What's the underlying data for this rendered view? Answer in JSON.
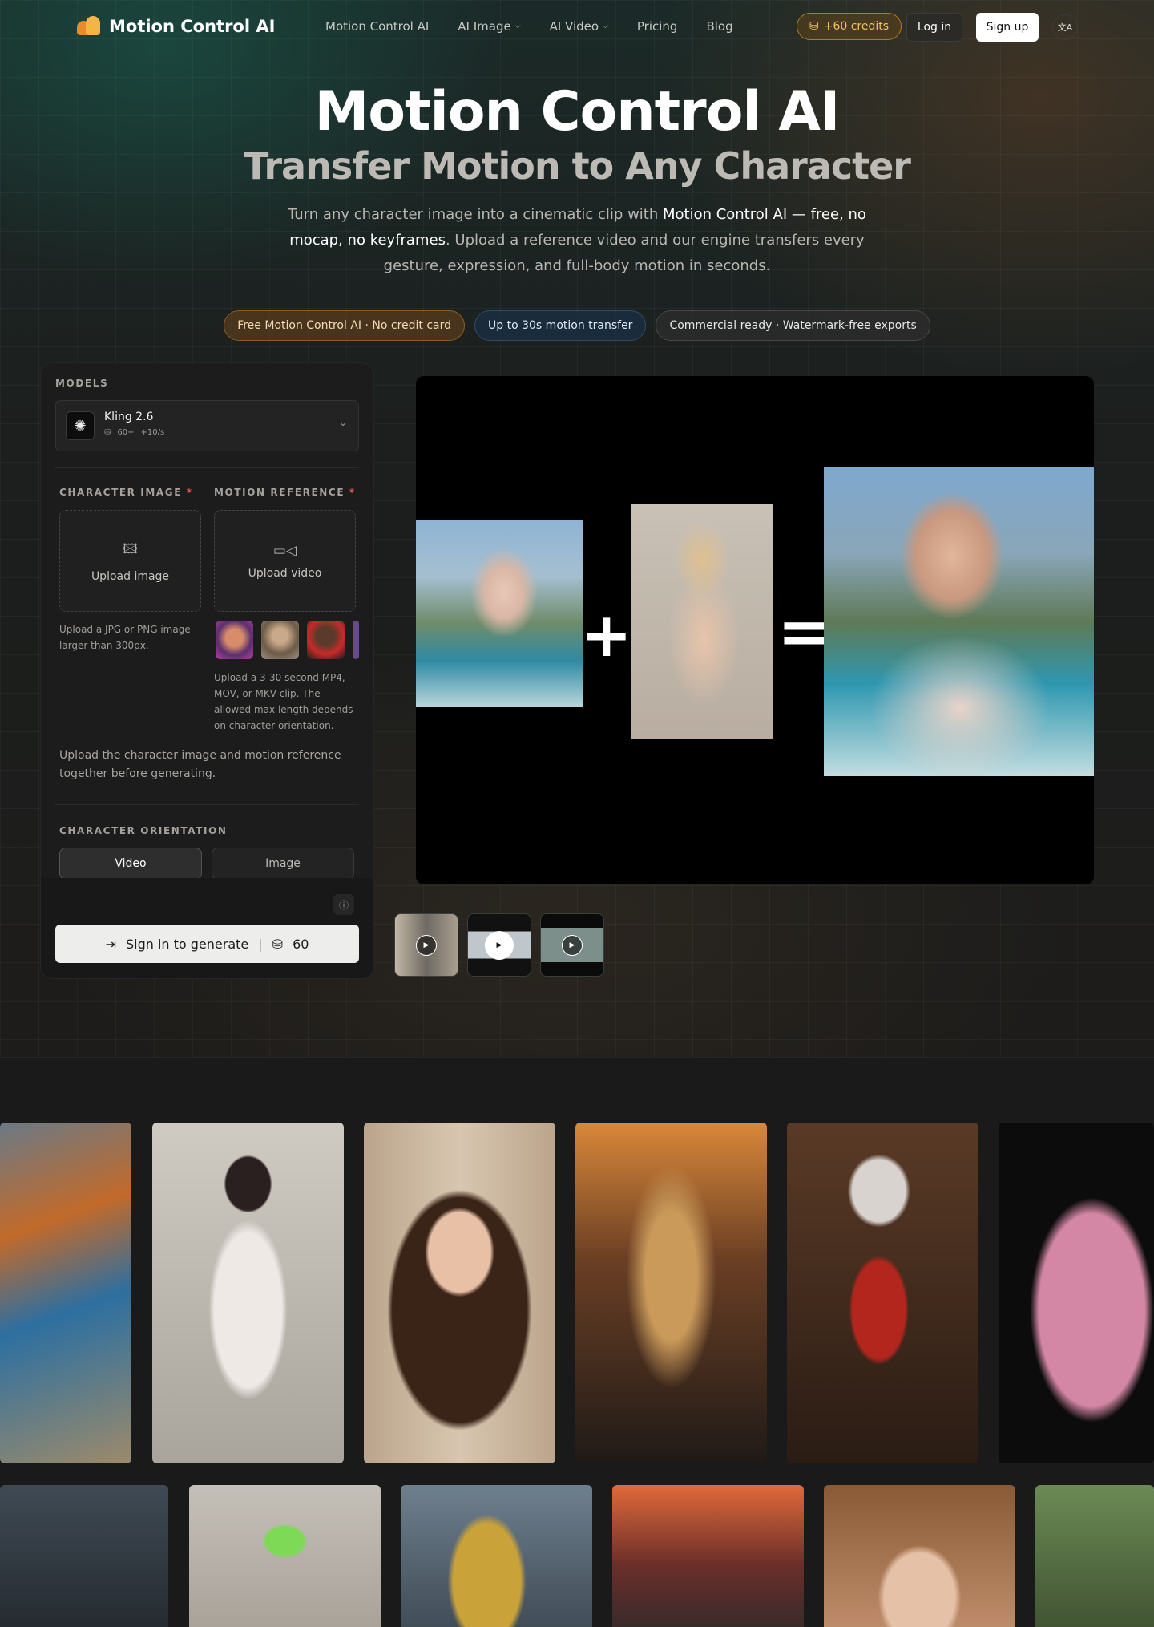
{
  "nav": {
    "brand": "Motion Control AI",
    "links": [
      {
        "label": "Motion Control AI",
        "active": true,
        "dropdown": false
      },
      {
        "label": "AI Image",
        "active": false,
        "dropdown": true
      },
      {
        "label": "AI Video",
        "active": false,
        "dropdown": true
      },
      {
        "label": "Pricing",
        "active": false,
        "dropdown": false
      },
      {
        "label": "Blog",
        "active": false,
        "dropdown": false
      }
    ],
    "credits": "+60 credits",
    "login": "Log in",
    "signup": "Sign up",
    "language_icon": "translate-icon"
  },
  "hero": {
    "title": "Motion Control AI",
    "subtitle": "Transfer Motion to Any Character",
    "desc_part1": "Turn any character image into a cinematic clip with ",
    "desc_highlight": "Motion Control AI — free, no mocap, no keyframes",
    "desc_part2": ". Upload a reference video and our engine transfers every gesture, expression, and full-body motion in seconds.",
    "badges": [
      "Free Motion Control AI · No credit card",
      "Up to 30s motion transfer",
      "Commercial ready · Watermark-free exports"
    ]
  },
  "panel": {
    "models_label": "MODELS",
    "model": {
      "name": "Kling 2.6",
      "credits": "60+",
      "rate": "+10/s"
    },
    "character_label": "CHARACTER IMAGE",
    "motion_label": "MOTION REFERENCE",
    "required_mark": "*",
    "upload_image": "Upload image",
    "upload_video": "Upload video",
    "image_help": "Upload a JPG or PNG image larger than 300px.",
    "video_help": "Upload a 3-30 second MP4, MOV, or MKV clip. The allowed max length depends on character orientation.",
    "note": "Upload the character image and motion reference together before generating.",
    "orientation_label": "CHARACTER ORIENTATION",
    "orientation_options": [
      "Video",
      "Image"
    ],
    "orientation_selected": "Video",
    "generate_label": "Sign in to generate",
    "generate_cost": "60"
  },
  "preview": {
    "plus": "+",
    "equals": "=",
    "thumbs_count": 3,
    "selected_thumb": 2
  },
  "colors": {
    "accent_amber": "#f5c163",
    "required": "#ef5350",
    "background": "#181818"
  }
}
